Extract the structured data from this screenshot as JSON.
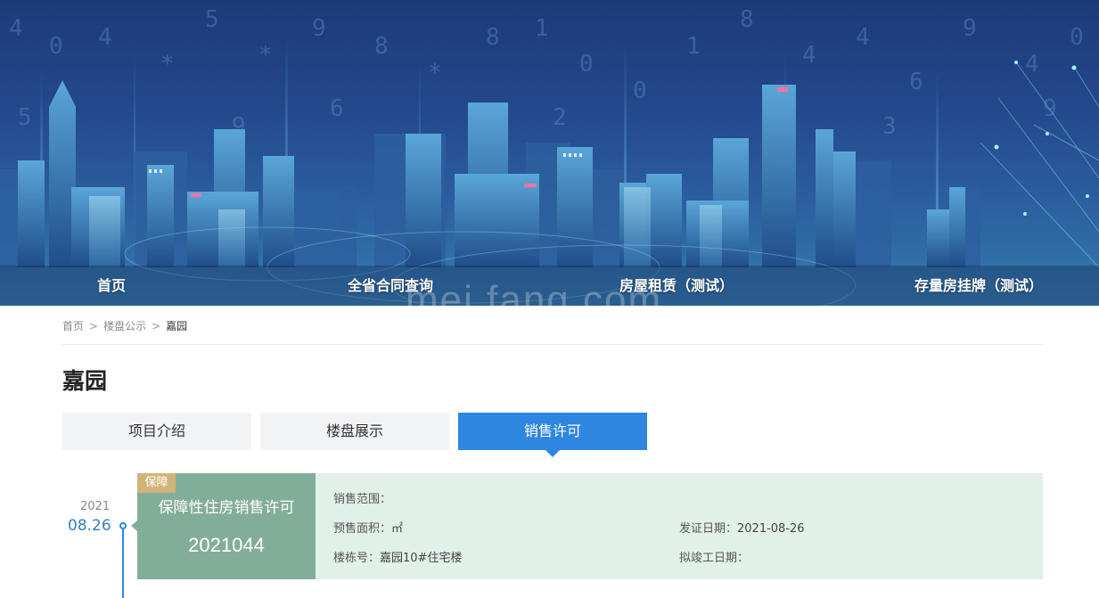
{
  "nav": {
    "items": [
      {
        "label": "首页"
      },
      {
        "label": "全省合同查询"
      },
      {
        "label": "房屋租赁（测试）"
      },
      {
        "label": "存量房挂牌（测试）"
      }
    ]
  },
  "watermark": "mei fang.com",
  "breadcrumb": {
    "home": "首页",
    "section": "楼盘公示",
    "current": "嘉园",
    "separator": ">"
  },
  "page_title": "嘉园",
  "tabs": [
    {
      "label": "项目介绍",
      "active": false
    },
    {
      "label": "楼盘展示",
      "active": false
    },
    {
      "label": "销售许可",
      "active": true
    }
  ],
  "timeline": {
    "year": "2021",
    "date": "08.26"
  },
  "permit": {
    "tag": "保障",
    "type": "保障性住房销售许可",
    "number": "2021044",
    "sales_scope_label": "销售范围：",
    "sales_scope_value": "",
    "presale_area_label": "预售面积：",
    "presale_area_value": "㎡",
    "issue_date_label": "发证日期：",
    "issue_date_value": "2021-08-26",
    "building_no_label": "楼栋号：",
    "building_no_value": "嘉园10#住宅楼",
    "completion_date_label": "拟竣工日期：",
    "completion_date_value": ""
  },
  "colors": {
    "accent": "#2f86e0",
    "card_green": "#82ae99",
    "card_bg": "#e1f0e9",
    "tag_gold": "#d2b47a"
  }
}
